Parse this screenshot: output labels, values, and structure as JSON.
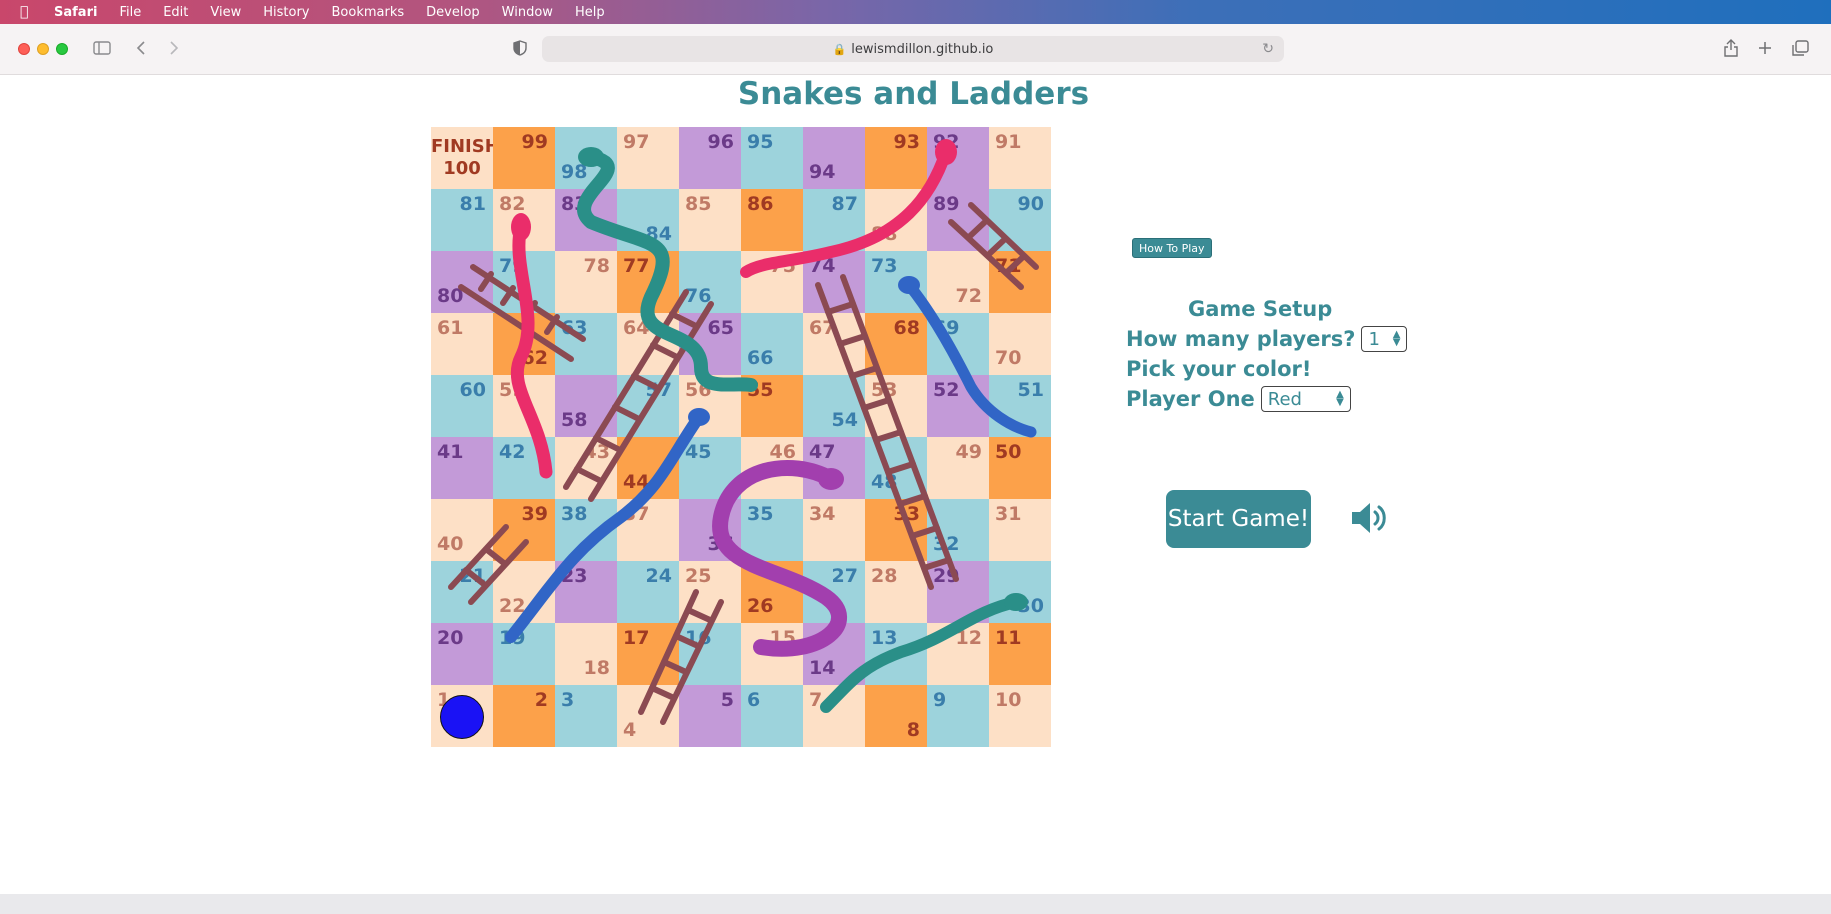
{
  "menubar": {
    "app": "Safari",
    "items": [
      "File",
      "Edit",
      "View",
      "History",
      "Bookmarks",
      "Develop",
      "Window",
      "Help"
    ]
  },
  "browser": {
    "url": "lewismdillon.github.io"
  },
  "game": {
    "title": "Snakes and Ladders",
    "finish_label": "FINISH",
    "board_rows": [
      [
        100,
        99,
        98,
        97,
        96,
        95,
        94,
        93,
        92,
        91
      ],
      [
        81,
        82,
        83,
        84,
        85,
        86,
        87,
        88,
        89,
        90
      ],
      [
        80,
        79,
        78,
        77,
        76,
        75,
        74,
        73,
        72,
        71
      ],
      [
        61,
        62,
        63,
        64,
        65,
        66,
        67,
        68,
        69,
        70
      ],
      [
        60,
        59,
        58,
        57,
        56,
        55,
        54,
        53,
        52,
        51
      ],
      [
        41,
        42,
        43,
        44,
        45,
        46,
        47,
        48,
        49,
        50
      ],
      [
        40,
        39,
        38,
        37,
        36,
        35,
        34,
        33,
        32,
        31
      ],
      [
        21,
        22,
        23,
        24,
        25,
        26,
        27,
        28,
        29,
        30
      ],
      [
        20,
        19,
        18,
        17,
        16,
        15,
        14,
        13,
        12,
        11
      ],
      [
        1,
        2,
        3,
        4,
        5,
        6,
        7,
        8,
        9,
        10
      ]
    ],
    "player_token_color": "#1a12f5",
    "player_token_square": 1
  },
  "setup": {
    "how_to_play": "How To Play",
    "heading": "Game Setup",
    "players_label": "How many players?",
    "players_value": "1",
    "color_prompt": "Pick your color!",
    "player_one_label": "Player One",
    "player_one_color": "Red",
    "start_button": "Start Game!"
  },
  "colors": {
    "accent": "#3b8b95",
    "orange": "#fca14a",
    "purple": "#c39ad8",
    "teal": "#9dd3dc",
    "cream": "#fde0c6"
  },
  "icons": [
    "apple-icon",
    "sidebar-icon",
    "back-icon",
    "forward-icon",
    "shield-icon",
    "lock-icon",
    "reload-icon",
    "share-icon",
    "new-tab-icon",
    "tabs-overview-icon",
    "speaker-icon"
  ]
}
